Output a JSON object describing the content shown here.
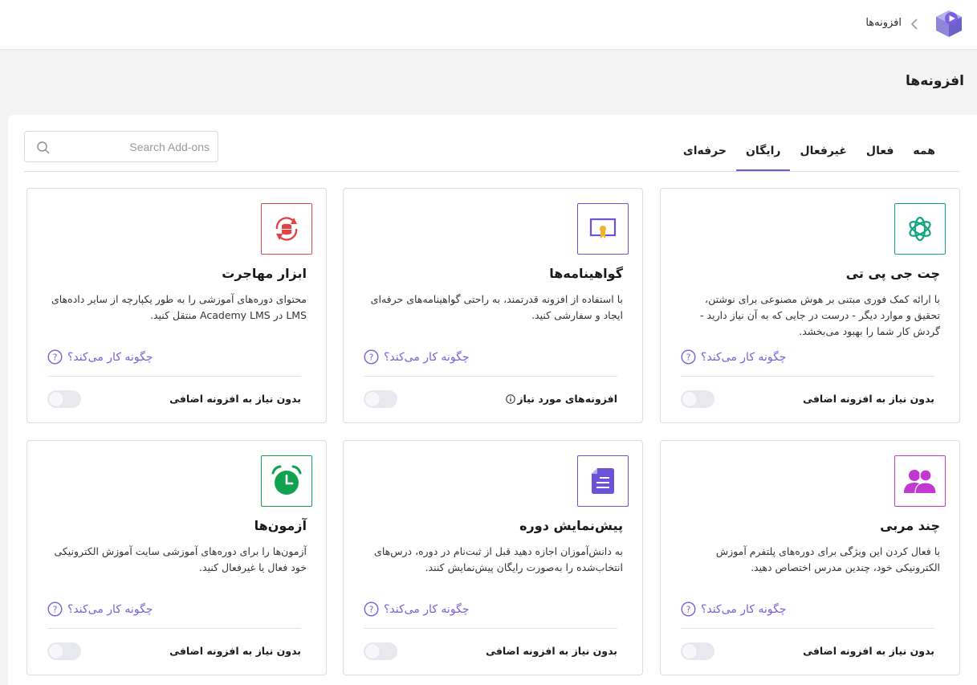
{
  "breadcrumb": {
    "current": "افزونه‌ها"
  },
  "page": {
    "title": "افزونه‌ها"
  },
  "tabs": [
    {
      "label": "همه"
    },
    {
      "label": "فعال"
    },
    {
      "label": "غیرفعال"
    },
    {
      "label": "رایگان",
      "active": true
    },
    {
      "label": "حرفه‌ای"
    }
  ],
  "search": {
    "placeholder": "Search Add-ons",
    "value": ""
  },
  "how_label": "چگونه کار می‌کند؟",
  "colors": {
    "accent": "#7b5fd6",
    "chatgpt": "#10a37f",
    "certificate": "#6b52d9",
    "migration": "#e04545",
    "multi_instructor": "#c13ad0",
    "course_preview": "#6b52d9",
    "quiz": "#10a34f"
  },
  "cards": [
    {
      "icon": "chatgpt-icon",
      "title": "چت جی پی تی",
      "description": "با ارائه کمک فوری مبتنی بر هوش مصنوعی برای نوشتن، تحقیق و موارد دیگر - درست در جایی که به آن نیاز دارید - گردش کار شما را بهبود می‌بخشد.",
      "requirement": "بدون نیاز به افزونه اضافی",
      "enabled": false
    },
    {
      "icon": "certificate-icon",
      "title": "گواهینامه‌ها",
      "description": "با استفاده از افزونه قدرتمند، به راحتی گواهینامه‌های حرفه‌ای ایجاد و سفارشی کنید.",
      "requirement": "افزونه‌های مورد نیاز",
      "enabled": false
    },
    {
      "icon": "migration-icon",
      "title": "ابزار مهاجرت",
      "description": "محتوای دوره‌های آموزشی را به طور یکپارچه از سایر داده‌های LMS در Academy LMS منتقل کنید.",
      "requirement": "بدون نیاز به افزونه اضافی",
      "enabled": false
    },
    {
      "icon": "multi-instructor-icon",
      "title": "چند مربی",
      "description": "با فعال کردن این ویژگی برای دوره‌های پلتفرم آموزش الکترونیکی خود، چندین مدرس اختصاص دهید.",
      "requirement": "بدون نیاز به افزونه اضافی",
      "enabled": false
    },
    {
      "icon": "course-preview-icon",
      "title": "پیش‌نمایش دوره",
      "description": "به دانش‌آموزان اجازه دهید قبل از ثبت‌نام در دوره، درس‌های انتخاب‌شده را به‌صورت رایگان پیش‌نمایش کنند.",
      "requirement": "بدون نیاز به افزونه اضافی",
      "enabled": false
    },
    {
      "icon": "quiz-alarm-icon",
      "title": "آزمون‌ها",
      "description": "آزمون‌ها را برای دوره‌های آموزشی سایت آموزش الکترونیکی خود فعال یا غیرفعال کنید.",
      "requirement": "بدون نیاز به افزونه اضافی",
      "enabled": false
    }
  ]
}
